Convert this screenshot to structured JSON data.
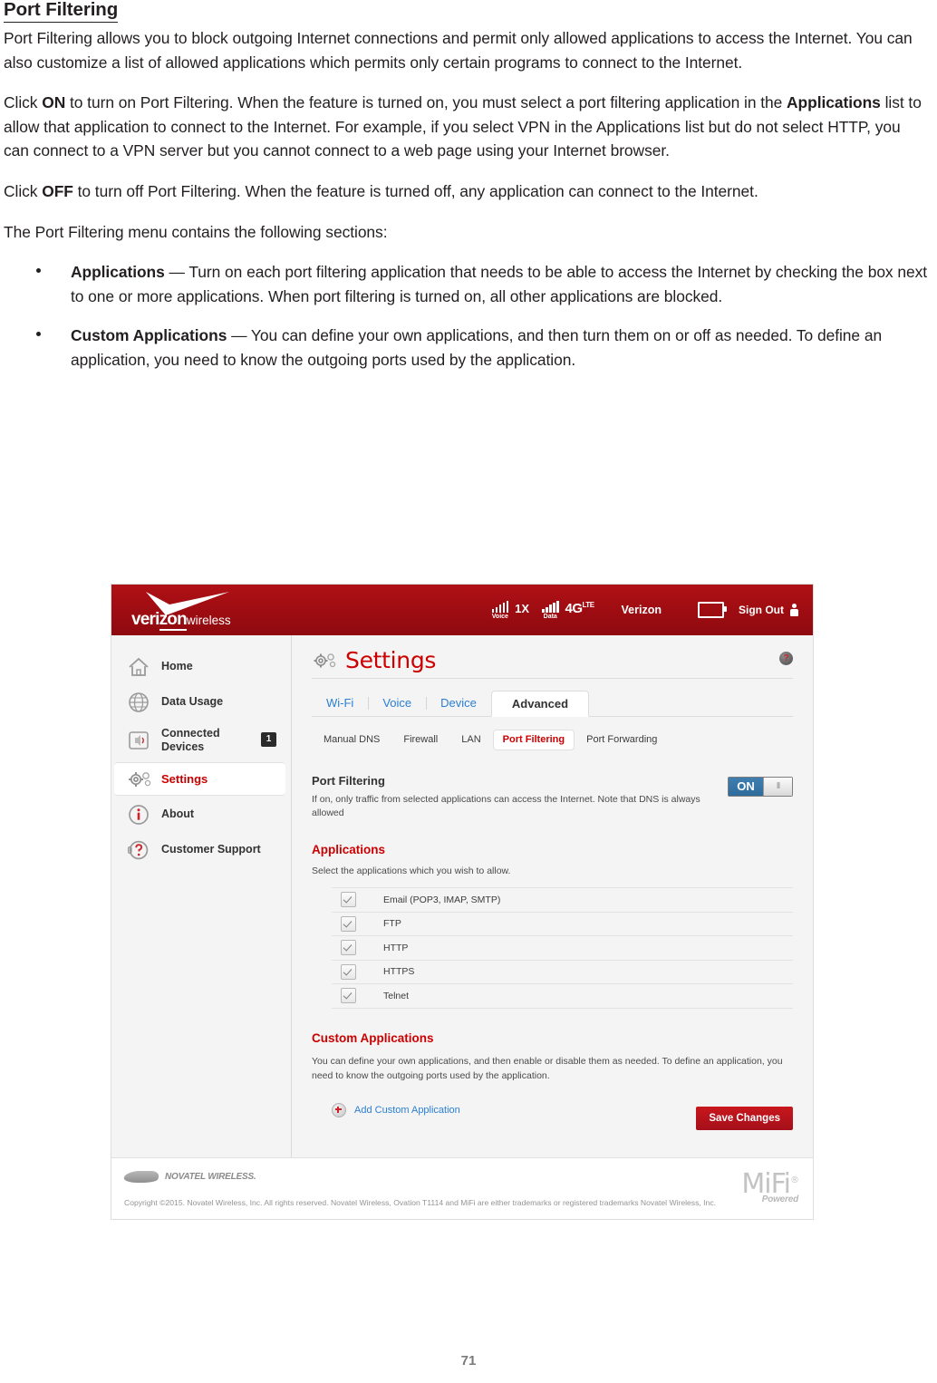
{
  "document": {
    "heading": "Port Filtering",
    "paragraphs": [
      {
        "id": "p1",
        "runs": [
          {
            "text": "Port Filtering allows you to block outgoing Internet connections and permit only allowed applications to access the Internet. You can also customize a list of allowed applications which permits only certain programs to connect to the Internet.",
            "bold": false
          }
        ]
      },
      {
        "id": "p2",
        "runs": [
          {
            "text": "Click ",
            "bold": false
          },
          {
            "text": "ON",
            "bold": true
          },
          {
            "text": " to turn on Port Filtering. When the feature is turned on, you must select a port filtering application in the ",
            "bold": false
          },
          {
            "text": "Applications",
            "bold": true
          },
          {
            "text": " list to allow that application to connect to the Internet. For example, if you select VPN in the Applications list but do not select HTTP, you can connect to a VPN server but you cannot connect to a web page using your Internet browser.",
            "bold": false
          }
        ]
      },
      {
        "id": "p3",
        "runs": [
          {
            "text": "Click ",
            "bold": false
          },
          {
            "text": "OFF",
            "bold": true
          },
          {
            "text": " to turn off Port Filtering. When the feature is turned off, any application can connect to the Internet.",
            "bold": false
          }
        ]
      },
      {
        "id": "p4",
        "runs": [
          {
            "text": "The Port Filtering menu contains the following sections:",
            "bold": false
          }
        ]
      }
    ],
    "bullets": [
      {
        "term": "Applications",
        "body": " — Turn on each port filtering application that needs to be able to access the Internet by checking the box next to one or more applications. When port filtering is turned on, all other applications are blocked."
      },
      {
        "term": "Custom Applications",
        "body": " — You can define your own applications, and then turn them on or off as needed. To define an application, you need to know the outgoing ports used by the application."
      }
    ],
    "page_number": "71"
  },
  "screenshot": {
    "header": {
      "brand_main": "veri",
      "brand_zon": "zon",
      "brand_suffix": "wireless",
      "voice_label": "Voice",
      "voice_tech": "1X",
      "data_label": "Data",
      "data_tech": "4G",
      "data_tech_sup": "LTE",
      "carrier": "Verizon",
      "sign_out": "Sign Out"
    },
    "sidebar": {
      "items": [
        {
          "label": "Home",
          "icon": "home-icon",
          "badge": null,
          "active": false
        },
        {
          "label": "Data Usage",
          "icon": "globe-icon",
          "badge": null,
          "active": false
        },
        {
          "label": "Connected Devices",
          "icon": "speaker-icon",
          "badge": "1",
          "active": false
        },
        {
          "label": "Settings",
          "icon": "gears-icon",
          "badge": null,
          "active": true
        },
        {
          "label": "About",
          "icon": "info-icon",
          "badge": null,
          "active": false
        },
        {
          "label": "Customer Support",
          "icon": "headset-question-icon",
          "badge": null,
          "active": false
        }
      ]
    },
    "panel": {
      "title": "Settings",
      "help_glyph": "?",
      "tabs": [
        {
          "label": "Wi-Fi",
          "active": false
        },
        {
          "label": "Voice",
          "active": false
        },
        {
          "label": "Device",
          "active": false
        },
        {
          "label": "Advanced",
          "active": true
        }
      ],
      "subtabs": [
        {
          "label": "Manual DNS",
          "active": false
        },
        {
          "label": "Firewall",
          "active": false
        },
        {
          "label": "LAN",
          "active": false
        },
        {
          "label": "Port Filtering",
          "active": true
        },
        {
          "label": "Port Forwarding",
          "active": false
        }
      ],
      "port_filtering": {
        "title": "Port Filtering",
        "description": "If on, only traffic from selected applications can access the Internet. Note that DNS is always allowed",
        "toggle_state": "ON",
        "toggle_knob": "II"
      },
      "applications": {
        "title": "Applications",
        "description": "Select the applications which you wish to allow.",
        "rows": [
          {
            "label": "Email (POP3, IMAP, SMTP)",
            "checked": true
          },
          {
            "label": "FTP",
            "checked": true
          },
          {
            "label": "HTTP",
            "checked": true
          },
          {
            "label": "HTTPS",
            "checked": true
          },
          {
            "label": "Telnet",
            "checked": true
          }
        ]
      },
      "custom_applications": {
        "title": "Custom Applications",
        "description": "You can define your own applications, and then enable or disable them as needed. To define an application, you need to know the outgoing ports used by the application.",
        "add_link": "Add Custom Application",
        "save_button": "Save Changes"
      }
    },
    "footer": {
      "novatel_text": "NOVATEL WIRELESS.",
      "copyright": "Copyright ©2015. Novatel Wireless, Inc. All rights reserved. Novatel Wireless, Ovation T1114 and MiFi are either trademarks or registered trademarks Novatel Wireless, Inc.",
      "mifi": "MiFi",
      "mifi_sup": "®",
      "mifi_powered": "Powered"
    },
    "colors": {
      "verizon_red": "#a00d12",
      "accent_red": "#cc0000",
      "link_blue": "#2a7fd4",
      "toggle_blue": "#2e6c9c"
    }
  }
}
